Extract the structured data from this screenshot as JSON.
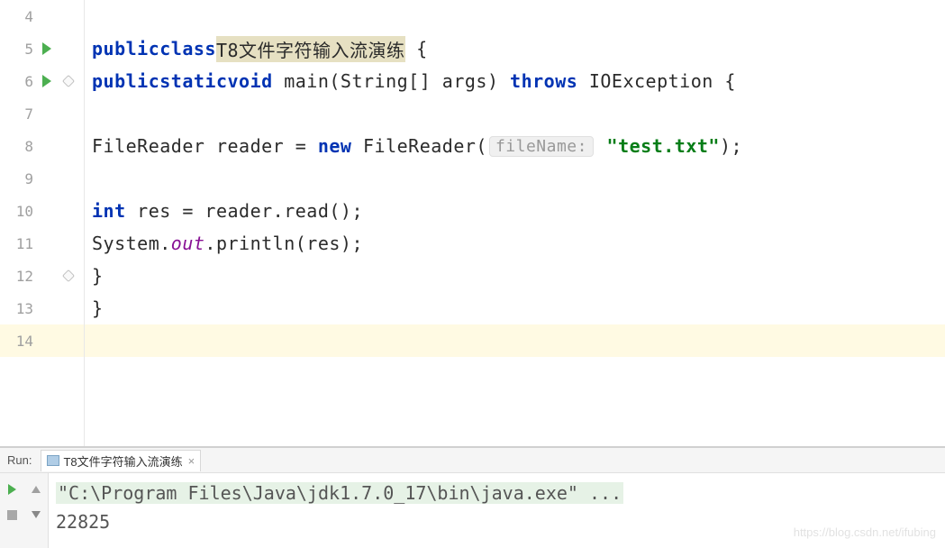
{
  "gutter": {
    "lines": [
      4,
      5,
      6,
      7,
      8,
      9,
      10,
      11,
      12,
      13,
      14
    ],
    "run_markers": [
      5,
      6
    ],
    "fold_markers": [
      6,
      12
    ],
    "current_line": 14
  },
  "code": {
    "l5": {
      "kw1": "public",
      "kw2": "class",
      "name": "T8文件字符输入流演练",
      "brace": " {"
    },
    "l6": {
      "kw1": "public",
      "kw2": "static",
      "kw3": "void",
      "sig": " main(String[] args) ",
      "kw4": "throws",
      "ex": " IOException {"
    },
    "l8": {
      "pre": "FileReader reader = ",
      "kw": "new",
      "mid": " FileReader(",
      "hint": "fileName:",
      "str": " \"test.txt\"",
      "post": ");"
    },
    "l10": {
      "kw": "int",
      "rest": " res = reader.read();"
    },
    "l11": {
      "pre": "System.",
      "field": "out",
      "post": ".println(res);"
    },
    "l12": "}",
    "l13": "}"
  },
  "run": {
    "label": "Run:",
    "tab": "T8文件字符输入流演练",
    "close": "×",
    "out_path": "\"C:\\Program Files\\Java\\jdk1.7.0_17\\bin\\java.exe\" ...",
    "out_value": "22825"
  },
  "watermark": "https://blog.csdn.net/ifubing"
}
